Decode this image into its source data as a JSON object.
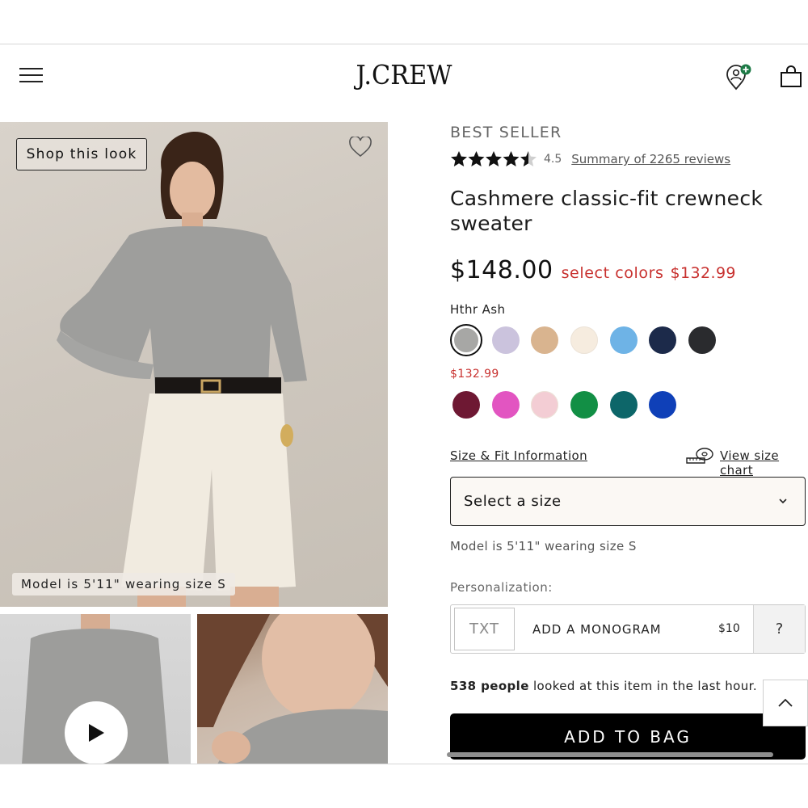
{
  "header": {
    "logo_text": "J.CREW"
  },
  "gallery": {
    "shop_look_label": "Shop this look",
    "model_caption": "Model is 5'11\" wearing size S"
  },
  "product": {
    "badge": "BEST SELLER",
    "rating": "4.5",
    "rating_value": 4.5,
    "reviews_link": "Summary of 2265 reviews",
    "name": "Cashmere classic-fit crewneck sweater",
    "price": "$148.00",
    "sale_label": "select colors",
    "sale_price": "$132.99",
    "selected_color": "Hthr Ash",
    "sale_colors_price": "$132.99",
    "colors_full_price": [
      "#a7a7a5",
      "#cbc3dd",
      "#d9b48f",
      "#f6ecdf",
      "#6eb3e6",
      "#1c2a4a",
      "#2a2b2e"
    ],
    "colors_sale": [
      "#6e1833",
      "#e255c1",
      "#f3cdd4",
      "#128f45",
      "#0d6669",
      "#0f40b8"
    ]
  },
  "sizing": {
    "size_fit_link": "Size & Fit Information",
    "size_chart_link": "View size chart",
    "select_placeholder": "Select a size",
    "model_info": "Model is 5'11\" wearing size S"
  },
  "personalization": {
    "label": "Personalization:",
    "txt": "TXT",
    "add_label": "ADD A MONOGRAM",
    "price": "$10",
    "help": "?"
  },
  "social_proof": {
    "count": "538 people",
    "text": " looked at this item in the last hour."
  },
  "cta": {
    "add_to_bag": "ADD TO BAG"
  }
}
